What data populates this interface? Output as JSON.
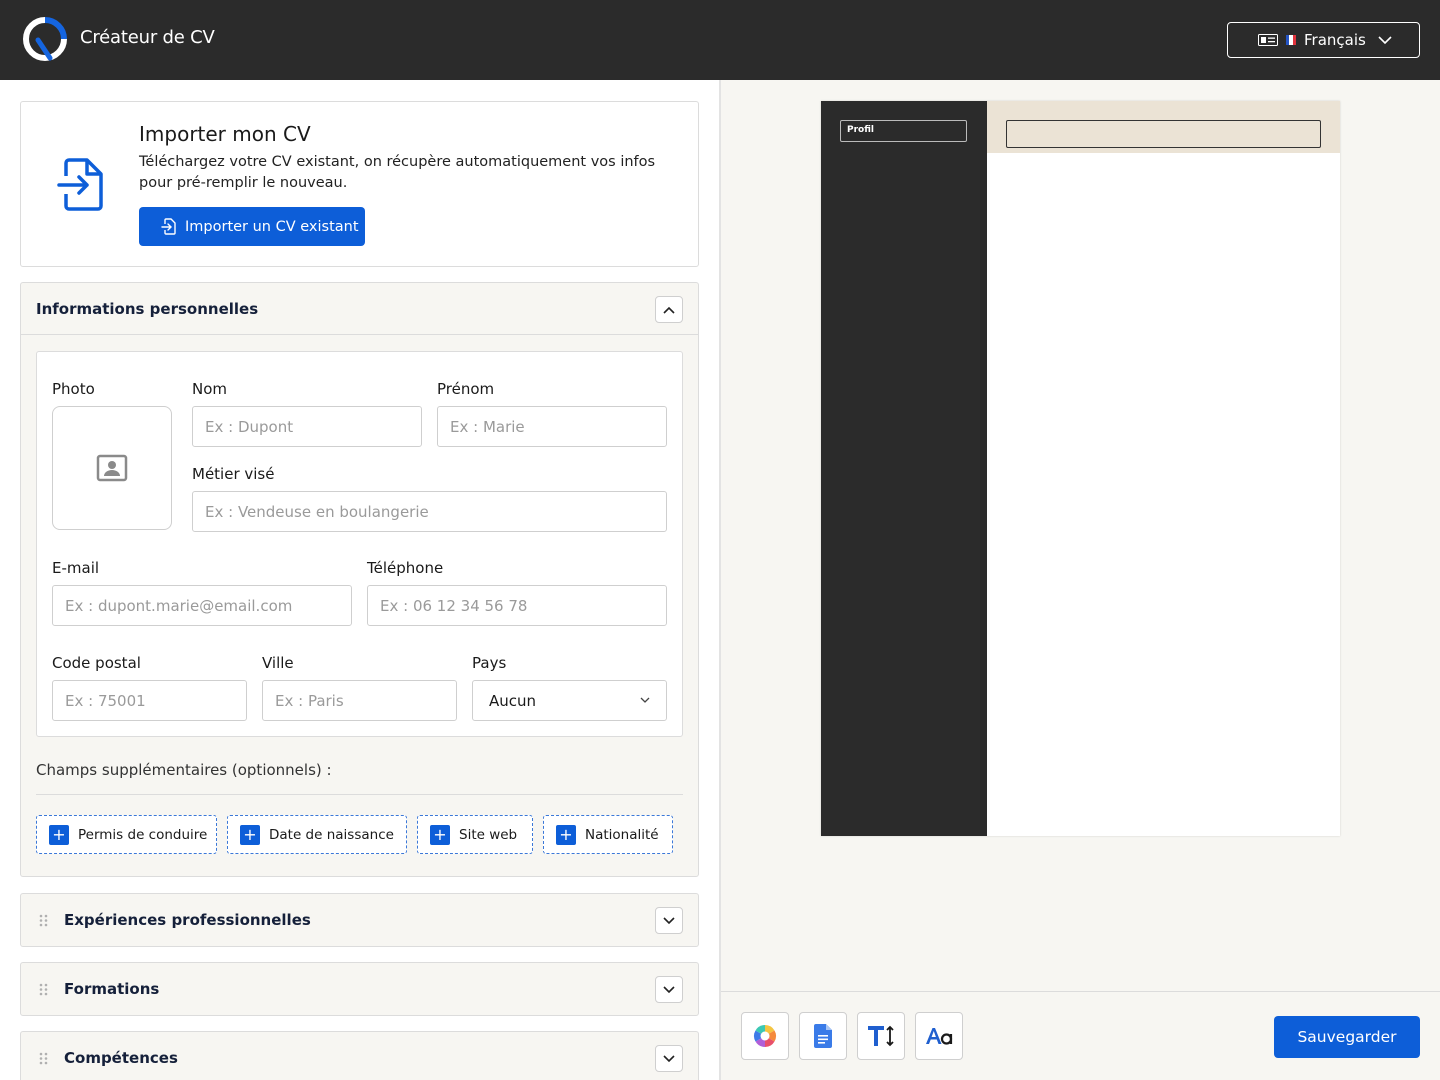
{
  "header": {
    "app_title": "Créateur de CV",
    "language": "Français"
  },
  "import": {
    "title": "Importer mon CV",
    "description": "Téléchargez votre CV existant, on récupère automatiquement vos infos pour pré-remplir le nouveau.",
    "button_label": "Importer un CV existant"
  },
  "personal": {
    "title": "Informations personnelles",
    "photo_label": "Photo",
    "nom": {
      "label": "Nom",
      "placeholder": "Ex : Dupont"
    },
    "prenom": {
      "label": "Prénom",
      "placeholder": "Ex : Marie"
    },
    "metier": {
      "label": "Métier visé",
      "placeholder": "Ex : Vendeuse en boulangerie"
    },
    "email": {
      "label": "E-mail",
      "placeholder": "Ex : dupont.marie@email.com"
    },
    "telephone": {
      "label": "Téléphone",
      "placeholder": "Ex : 06 12 34 56 78"
    },
    "code_postal": {
      "label": "Code postal",
      "placeholder": "Ex : 75001"
    },
    "ville": {
      "label": "Ville",
      "placeholder": "Ex : Paris"
    },
    "pays": {
      "label": "Pays",
      "value": "Aucun"
    },
    "extra_label": "Champs supplémentaires (optionnels) :",
    "extra_fields": [
      "Permis de conduire",
      "Date de naissance",
      "Site web",
      "Nationalité"
    ]
  },
  "sections": [
    {
      "title": "Expériences professionnelles"
    },
    {
      "title": "Formations"
    },
    {
      "title": "Compétences"
    }
  ],
  "preview": {
    "profil_label": "Profil"
  },
  "toolbar": {
    "icons": [
      "color-palette-icon",
      "document-icon",
      "text-size-icon",
      "font-icon"
    ],
    "save_label": "Sauvegarder"
  },
  "colors": {
    "accent": "#0d5ed8",
    "header_bg": "#2b2b2b",
    "preview_sidebar": "#2b2b2b",
    "preview_header": "#ebe3d5"
  }
}
